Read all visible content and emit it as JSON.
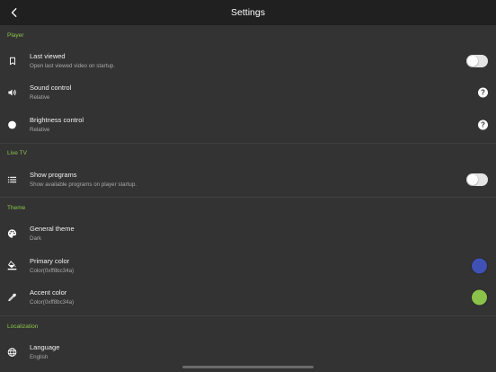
{
  "appbar": {
    "title": "Settings",
    "back_icon": "chevron-left-icon"
  },
  "sections": {
    "player": {
      "header": "Player",
      "last_viewed": {
        "title": "Last viewed",
        "subtitle": "Open last viewed video on startup.",
        "icon": "bookmark-icon",
        "toggle_on": false
      },
      "sound_control": {
        "title": "Sound control",
        "subtitle": "Relative",
        "icon": "volume-icon",
        "help": "?"
      },
      "brightness_control": {
        "title": "Brightness control",
        "subtitle": "Relative",
        "icon": "brightness-icon",
        "help": "?"
      }
    },
    "live_tv": {
      "header": "Live TV",
      "show_programs": {
        "title": "Show programs",
        "subtitle": "Show available programs on player startup.",
        "icon": "list-icon",
        "toggle_on": false
      }
    },
    "theme": {
      "header": "Theme",
      "general_theme": {
        "title": "General theme",
        "subtitle": "Dark",
        "icon": "palette-icon"
      },
      "primary_color": {
        "title": "Primary color",
        "subtitle": "Color(0xff8bc34a)",
        "icon": "format-color-fill-icon",
        "swatch_color": "#3f51b5"
      },
      "accent_color": {
        "title": "Accent color",
        "subtitle": "Color(0xff8bc34a)",
        "icon": "colorize-icon",
        "swatch_color": "#8bc34a"
      }
    },
    "localization": {
      "header": "Localization",
      "language": {
        "title": "Language",
        "subtitle": "English",
        "icon": "globe-icon"
      }
    }
  },
  "colors": {
    "accent": "#8bc34a",
    "background": "#333333",
    "appbar": "#202020"
  }
}
